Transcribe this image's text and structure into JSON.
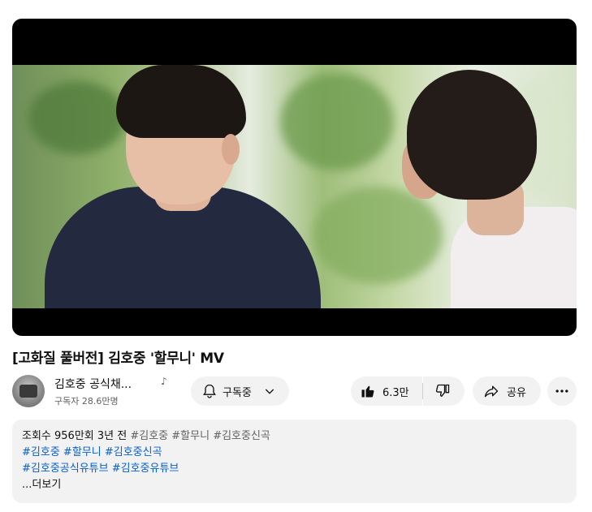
{
  "video": {
    "title": "[고화질 풀버전] 김호중 '할무니' MV"
  },
  "channel": {
    "name": "김호중 공식채...",
    "subscribers": "구독자 28.6만명",
    "badge_icon": "music-note-icon"
  },
  "actions": {
    "subscribe_label": "구독중",
    "like_count": "6.3만",
    "share_label": "공유"
  },
  "description": {
    "views": "조회수 956만회",
    "age": "3년 전",
    "inline_tags": [
      "#김호중",
      "#할무니",
      "#김호중신곡"
    ],
    "tags_row1": [
      "#김호중",
      "#할무니",
      "#김호중신곡"
    ],
    "tags_row2": [
      "#김호중공식유튜브",
      "#김호중유튜브"
    ],
    "more_label": "...더보기"
  },
  "colors": {
    "link": "#065fd4",
    "pill_bg": "#f2f2f2",
    "secondary_text": "#606060"
  }
}
